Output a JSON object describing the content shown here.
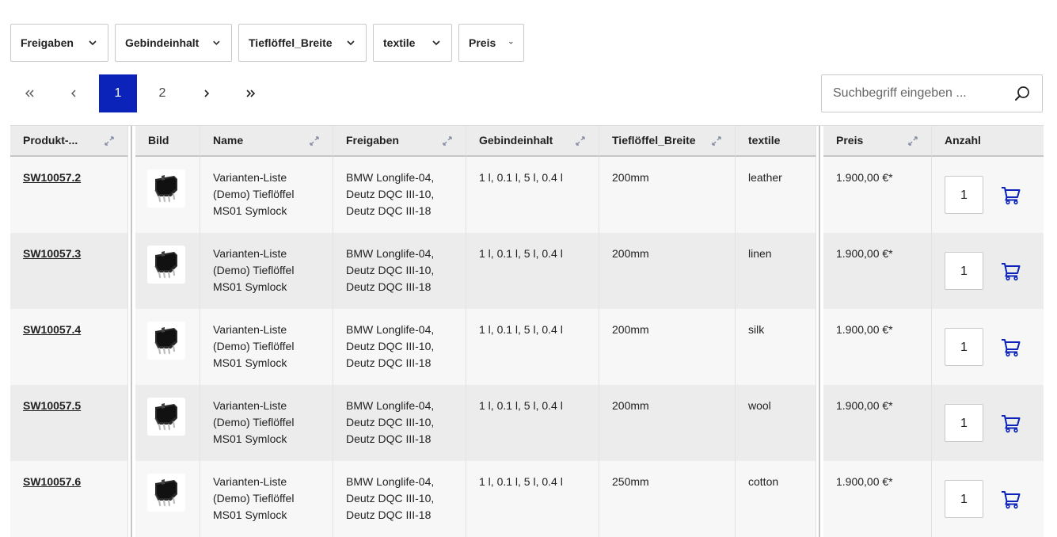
{
  "filters": [
    {
      "label": "Freigaben"
    },
    {
      "label": "Gebindeinhalt"
    },
    {
      "label": "Tieflöffel_Breite"
    },
    {
      "label": "textile"
    },
    {
      "label": "Preis"
    }
  ],
  "pagination": {
    "pages": [
      "1",
      "2"
    ],
    "current": "1"
  },
  "search": {
    "placeholder": "Suchbegriff eingeben ..."
  },
  "table": {
    "headers": {
      "sku": "Produkt-...",
      "image": "Bild",
      "name": "Name",
      "freigaben": "Freigaben",
      "gebindeinhalt": "Gebindeinhalt",
      "tiefloeffel": "Tieflöffel_Breite",
      "textile": "textile",
      "price": "Preis",
      "qty": "Anzahl"
    },
    "rows": [
      {
        "sku": "SW10057.2",
        "name1": "Varianten-Liste",
        "name2": "(Demo) Tieflöffel",
        "name3": "MS01 Symlock",
        "frei1": "BMW Longlife-04,",
        "frei2": "Deutz DQC III-10,",
        "frei3": "Deutz DQC III-18",
        "geb": "1 l, 0.1 l, 5 l, 0.4 l",
        "tief": "200mm",
        "textile": "leather",
        "price": "1.900,00 €*",
        "qty": "1"
      },
      {
        "sku": "SW10057.3",
        "name1": "Varianten-Liste",
        "name2": "(Demo) Tieflöffel",
        "name3": "MS01 Symlock",
        "frei1": "BMW Longlife-04,",
        "frei2": "Deutz DQC III-10,",
        "frei3": "Deutz DQC III-18",
        "geb": "1 l, 0.1 l, 5 l, 0.4 l",
        "tief": "200mm",
        "textile": "linen",
        "price": "1.900,00 €*",
        "qty": "1"
      },
      {
        "sku": "SW10057.4",
        "name1": "Varianten-Liste",
        "name2": "(Demo) Tieflöffel",
        "name3": "MS01 Symlock",
        "frei1": "BMW Longlife-04,",
        "frei2": "Deutz DQC III-10,",
        "frei3": "Deutz DQC III-18",
        "geb": "1 l, 0.1 l, 5 l, 0.4 l",
        "tief": "200mm",
        "textile": "silk",
        "price": "1.900,00 €*",
        "qty": "1"
      },
      {
        "sku": "SW10057.5",
        "name1": "Varianten-Liste",
        "name2": "(Demo) Tieflöffel",
        "name3": "MS01 Symlock",
        "frei1": "BMW Longlife-04,",
        "frei2": "Deutz DQC III-10,",
        "frei3": "Deutz DQC III-18",
        "geb": "1 l, 0.1 l, 5 l, 0.4 l",
        "tief": "200mm",
        "textile": "wool",
        "price": "1.900,00 €*",
        "qty": "1"
      },
      {
        "sku": "SW10057.6",
        "name1": "Varianten-Liste",
        "name2": "(Demo) Tieflöffel",
        "name3": "MS01 Symlock",
        "frei1": "BMW Longlife-04,",
        "frei2": "Deutz DQC III-10,",
        "frei3": "Deutz DQC III-18",
        "geb": "1 l, 0.1 l, 5 l, 0.4 l",
        "tief": "250mm",
        "textile": "cotton",
        "price": "1.900,00 €*",
        "qty": "1"
      }
    ]
  },
  "icons": {
    "filter_chevron": "chevron-down-icon",
    "first_page": "double-chevron-left-icon",
    "prev_page": "chevron-left-icon",
    "next_page": "chevron-right-icon",
    "last_page": "double-chevron-right-icon",
    "search": "search-icon",
    "sort": "sort-icon",
    "cart": "cart-icon",
    "thumbnail": "excavator-bucket-image"
  },
  "colors": {
    "accent": "#0b23b8",
    "cart_icon": "#0b23b8",
    "header_bg": "#ececec"
  }
}
